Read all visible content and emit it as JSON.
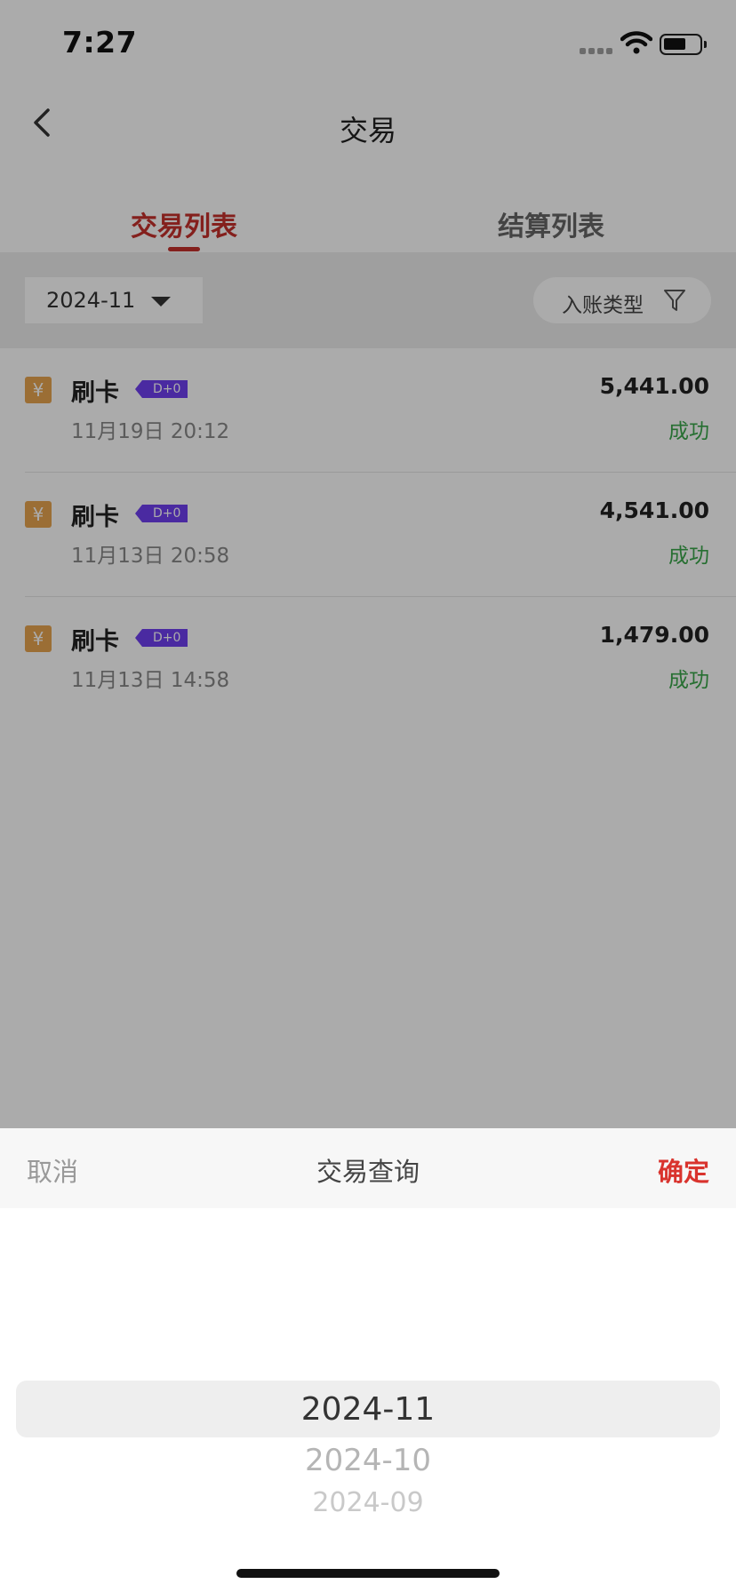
{
  "status_bar": {
    "time": "7:27"
  },
  "nav": {
    "title": "交易"
  },
  "tabs": [
    {
      "label": "交易列表",
      "active": true
    },
    {
      "label": "结算列表",
      "active": false
    }
  ],
  "filter": {
    "month": "2024-11",
    "type_label": "入账类型"
  },
  "transactions": [
    {
      "icon": "¥",
      "type": "刷卡",
      "tag": "D+0",
      "time": "11月19日 20:12",
      "amount": "5,441.00",
      "status": "成功"
    },
    {
      "icon": "¥",
      "type": "刷卡",
      "tag": "D+0",
      "time": "11月13日 20:58",
      "amount": "4,541.00",
      "status": "成功"
    },
    {
      "icon": "¥",
      "type": "刷卡",
      "tag": "D+0",
      "time": "11月13日 14:58",
      "amount": "1,479.00",
      "status": "成功"
    }
  ],
  "picker": {
    "cancel": "取消",
    "title": "交易查询",
    "confirm": "确定",
    "options": [
      "2024-11",
      "2024-10",
      "2024-09"
    ],
    "selected": "2024-11"
  },
  "colors": {
    "accent_red": "#c5312c",
    "success_green": "#3aa64a",
    "tag_purple": "#6f3ff0",
    "coin_orange": "#e8a44f"
  }
}
